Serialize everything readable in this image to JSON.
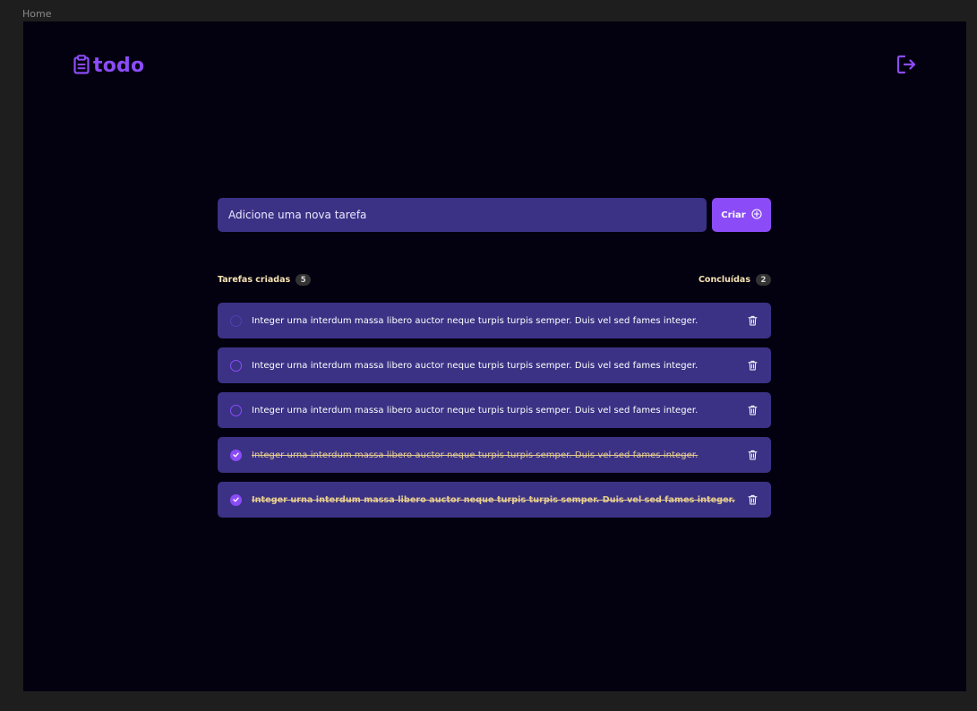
{
  "frame": {
    "label": "Home"
  },
  "header": {
    "logo_text": "todo",
    "logo_icon": "clipboard-icon",
    "logout_icon": "sign-out-icon"
  },
  "new_task": {
    "placeholder": "Adicione uma nova tarefa",
    "value": "",
    "create_label": "Criar",
    "create_icon": "plus-circle-icon"
  },
  "counters": {
    "created_label": "Tarefas criadas",
    "created_count": "5",
    "done_label": "Concluídas",
    "done_count": "2"
  },
  "tasks": [
    {
      "text": "Integer urna interdum massa libero auctor neque turpis turpis semper. Duis vel sed fames integer.",
      "done": false
    },
    {
      "text": "Integer urna interdum massa libero auctor neque turpis turpis semper. Duis vel sed fames integer.",
      "done": false
    },
    {
      "text": "Integer urna interdum massa libero auctor neque turpis turpis semper. Duis vel sed fames integer.",
      "done": false
    },
    {
      "text": "Integer urna interdum massa libero auctor neque turpis turpis semper. Duis vel sed fames integer.",
      "done": true
    },
    {
      "text": "Integer urna interdum massa libero auctor neque turpis turpis semper. Duis vel sed fames integer.",
      "done": true
    }
  ],
  "colors": {
    "background": "#03000f",
    "accent": "#8b4cf7",
    "card": "#3b3285",
    "done_text": "#e6cd8f"
  }
}
